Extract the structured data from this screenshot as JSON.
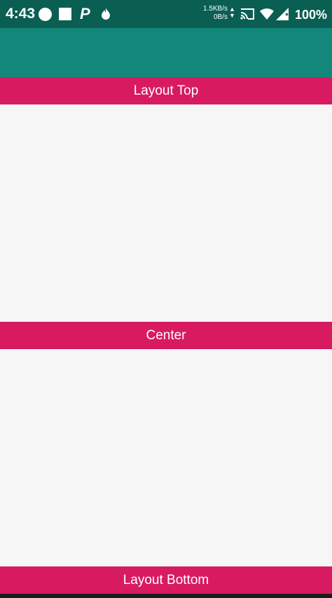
{
  "status_bar": {
    "time": "4:43",
    "net_up": "1.5KB/s",
    "net_down": "0B/s",
    "battery": "100%",
    "icons": [
      "circle-icon",
      "square-icon",
      "p-icon",
      "flame-icon",
      "updown-icon",
      "cast-icon",
      "wifi-icon",
      "signal-icon"
    ]
  },
  "layout": {
    "top_label": "Layout Top",
    "center_label": "Center",
    "bottom_label": "Layout Bottom"
  },
  "colors": {
    "status_bar": "#0a5e52",
    "app_bar": "#13877a",
    "band": "#d81b60",
    "background": "#f6f6f6"
  }
}
